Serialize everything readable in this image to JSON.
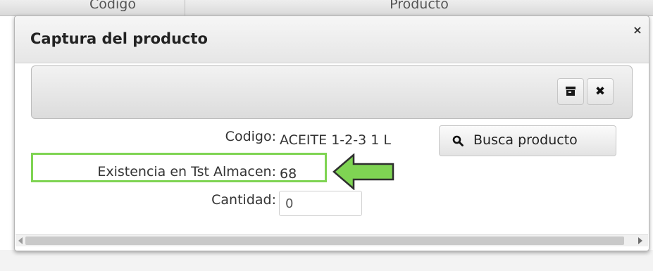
{
  "background_grid": {
    "columns": [
      "Codigo",
      "Producto"
    ]
  },
  "dialog": {
    "title": "Captura del producto",
    "close_glyph": "×"
  },
  "toolbar": {
    "buttons": [
      {
        "name": "archive-icon",
        "label": ""
      },
      {
        "name": "close-icon",
        "glyph": "✖"
      }
    ]
  },
  "form": {
    "codigo_label": "Codigo:",
    "codigo_value": "ACEITE 1-2-3 1 L",
    "existencia_label": "Existencia en Tst Almacen:",
    "existencia_value": "68",
    "cantidad_label": "Cantidad:",
    "cantidad_value": "0",
    "search_button_label": "Busca producto",
    "search_icon": "search-icon"
  },
  "annotation": {
    "highlight_color": "#7fd453",
    "arrow_color": "#7fd453",
    "arrow_icon": "arrow-left-icon"
  }
}
